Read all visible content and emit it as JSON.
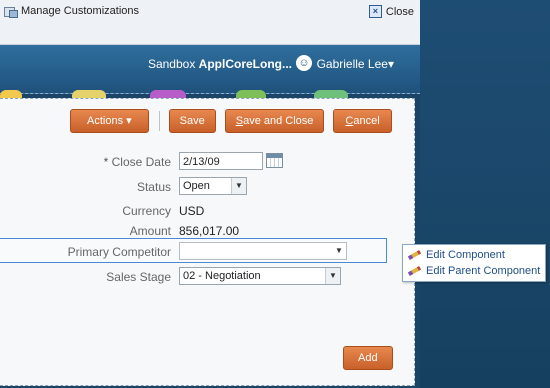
{
  "topbar": {
    "title": "Manage Customizations",
    "close_label": "Close"
  },
  "header": {
    "sandbox_prefix": "Sandbox ",
    "sandbox_name": "ApplCoreLong...",
    "user": "Gabrielle Lee",
    "user_caret": "▾"
  },
  "actions": {
    "actions_label": "Actions",
    "save_label": "Save",
    "save_close_first": "S",
    "save_close_rest": "ave and Close",
    "cancel_first": "C",
    "cancel_rest": "ancel",
    "add_label": "Add"
  },
  "form": {
    "close_date": {
      "label": "Close Date",
      "required_mark": "*",
      "value": "2/13/09"
    },
    "status": {
      "label": "Status",
      "value": "Open"
    },
    "currency": {
      "label": "Currency",
      "value": "USD"
    },
    "amount": {
      "label": "Amount",
      "value": "856,017.00"
    },
    "primary_competitor": {
      "label": "Primary Competitor",
      "value": ""
    },
    "sales_stage": {
      "label": "Sales Stage",
      "value": "02 - Negotiation"
    }
  },
  "popup": {
    "edit_component": "Edit Component",
    "edit_parent_component": "Edit Parent Component"
  },
  "colors": {
    "button_orange": "#d56c36",
    "header_blue": "#1f527c",
    "link_blue": "#1f4f86"
  }
}
